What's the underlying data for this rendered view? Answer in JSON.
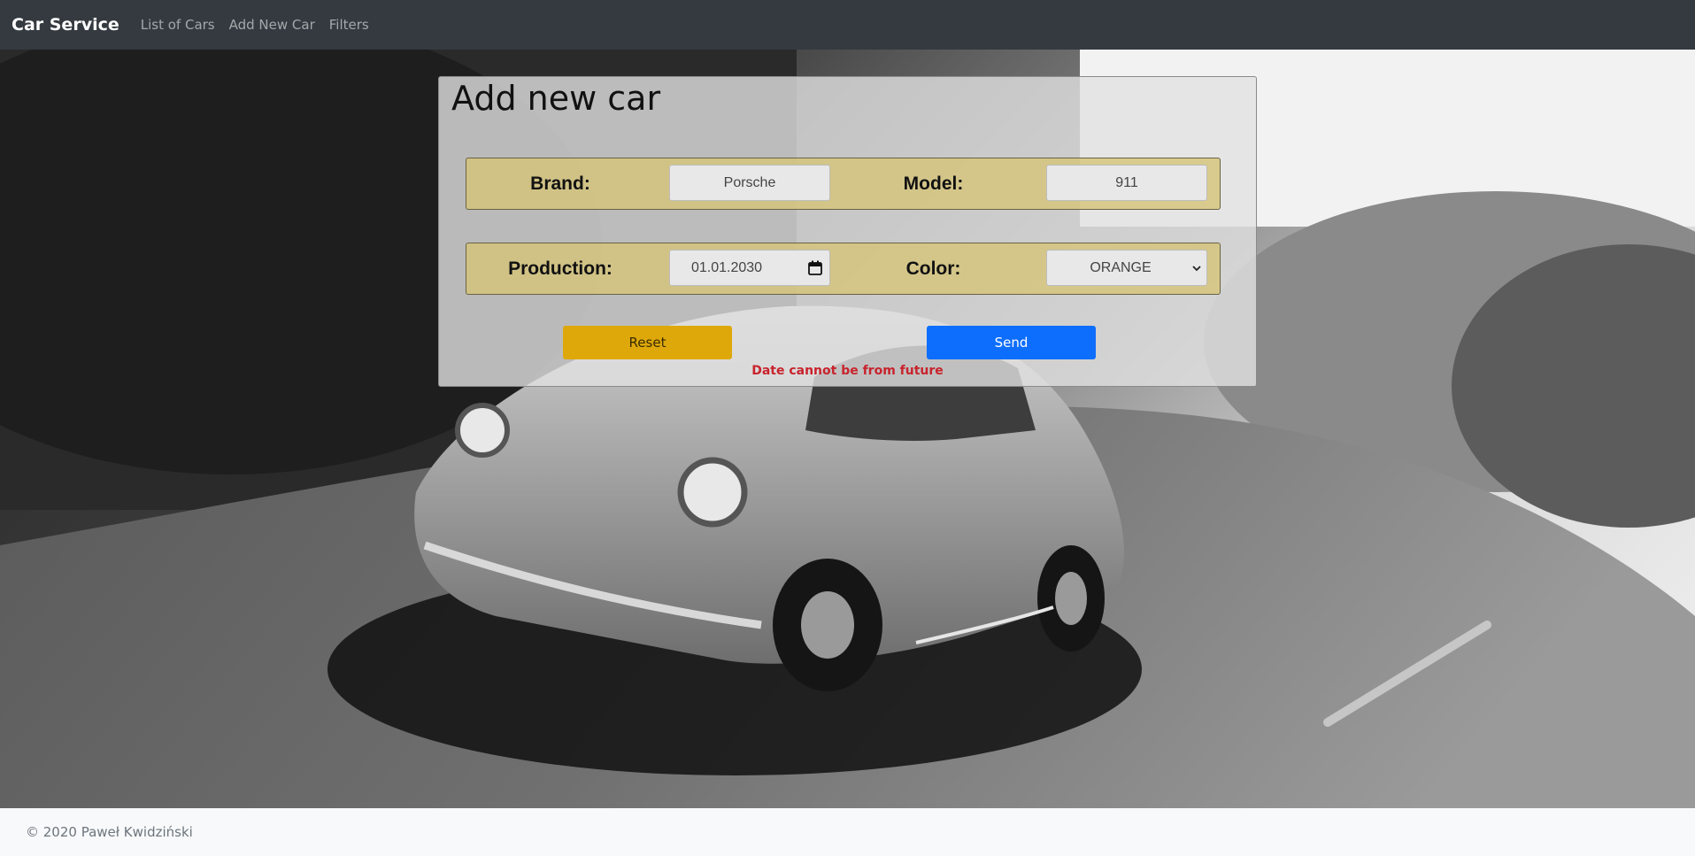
{
  "navbar": {
    "brand": "Car Service",
    "links": [
      "List of Cars",
      "Add New Car",
      "Filters"
    ]
  },
  "form": {
    "title": "Add new car",
    "brand_label": "Brand:",
    "brand_value": "Porsche",
    "model_label": "Model:",
    "model_value": "911",
    "production_label": "Production:",
    "production_value": "01.01.2030",
    "color_label": "Color:",
    "color_value": "ORANGE",
    "reset_label": "Reset",
    "send_label": "Send",
    "error_message": "Date cannot be from future"
  },
  "footer": {
    "text": "© 2020 Paweł Kwidziński"
  },
  "colors": {
    "navbar_bg": "#343a40",
    "row_bg": "#d6c478",
    "reset_bg": "#dea80a",
    "send_bg": "#0d6efd",
    "error": "#c8232c",
    "footer_bg": "#f8f9fa"
  },
  "icons": {
    "date": "calendar-icon",
    "select": "chevron-down-icon",
    "background": "car-photo"
  }
}
